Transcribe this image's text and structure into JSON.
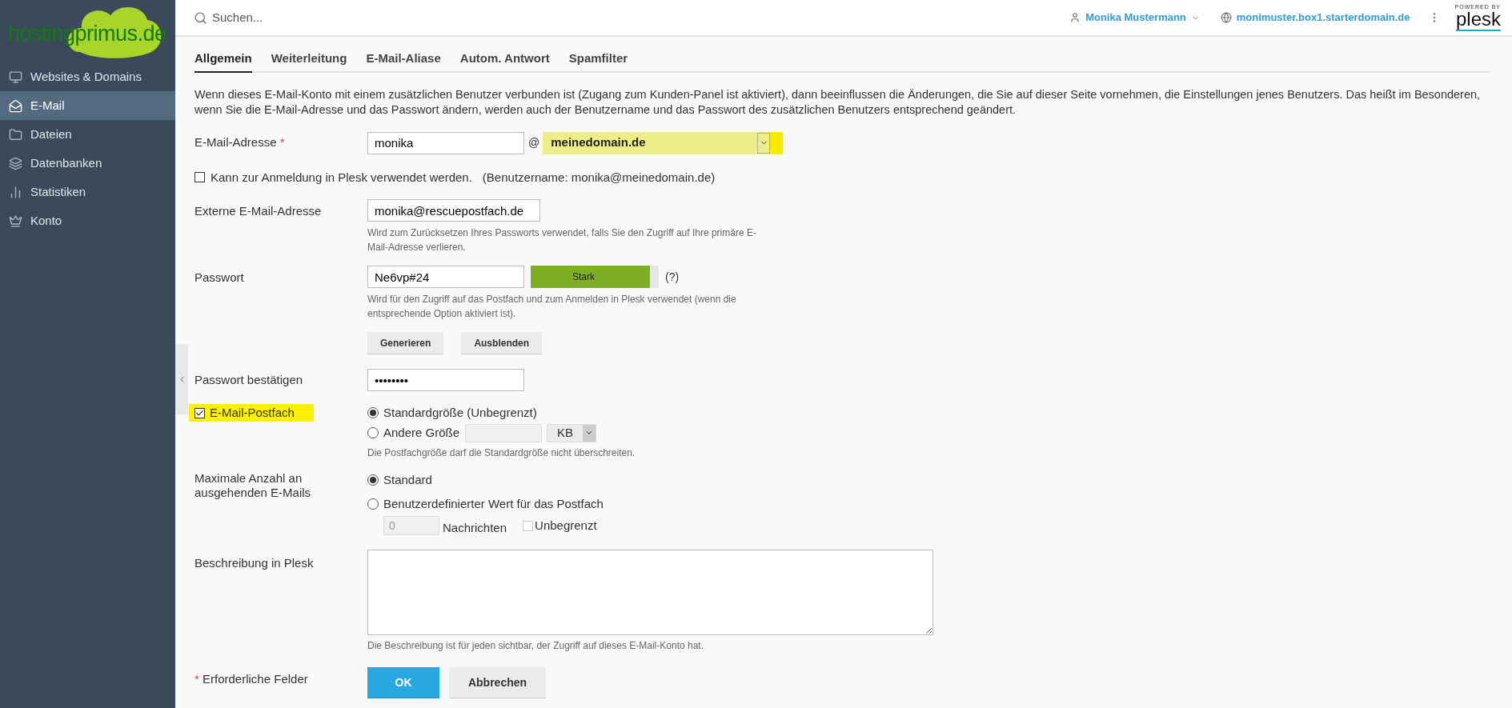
{
  "logo": {
    "text": "hostingprimus.de"
  },
  "sidebar": {
    "items": [
      {
        "label": "Websites & Domains",
        "selected": false
      },
      {
        "label": "E-Mail",
        "selected": true
      },
      {
        "label": "Dateien",
        "selected": false
      },
      {
        "label": "Datenbanken",
        "selected": false
      },
      {
        "label": "Statistiken",
        "selected": false
      },
      {
        "label": "Konto",
        "selected": false
      }
    ]
  },
  "topbar": {
    "search": {
      "placeholder": "Suchen..."
    },
    "user": "Monika Mustermann",
    "domain": "monimuster.box1.starterdomain.de",
    "brand": {
      "tagline": "POWERED BY",
      "name": "plesk"
    }
  },
  "tabs": [
    {
      "label": "Allgemein",
      "selected": true
    },
    {
      "label": "Weiterleitung",
      "selected": false
    },
    {
      "label": "E-Mail-Aliase",
      "selected": false
    },
    {
      "label": "Autom. Antwort",
      "selected": false
    },
    {
      "label": "Spamfilter",
      "selected": false
    }
  ],
  "intro": "Wenn dieses E-Mail-Konto mit einem zusätzlichen Benutzer verbunden ist (Zugang zum Kunden-Panel ist aktiviert), dann beeinflussen die Änderungen, die Sie auf dieser Seite vornehmen, die Einstellungen jenes Benutzers. Das heißt im Besonderen, wenn Sie die E-Mail-Adresse und das Passwort ändern, werden auch der Benutzername und das Passwort des zusätzlichen Benutzers entsprechend geändert.",
  "form": {
    "email": {
      "label": "E-Mail-Adresse",
      "required_mark": "*",
      "local": "monika",
      "at": "@",
      "domain": "meinedomain.de",
      "highlighted": true
    },
    "plesk_login": {
      "checked": false,
      "label": "Kann zur Anmeldung in Plesk verwendet werden.",
      "note": "(Benutzername: monika@meinedomain.de)"
    },
    "external": {
      "label": "Externe E-Mail-Adresse",
      "value": "monika@rescuepostfach.de",
      "hint": "Wird zum Zurücksetzen Ihres Passworts verwendet, falls Sie den Zugriff auf Ihre primäre E-Mail-Adresse verlieren."
    },
    "password": {
      "label": "Passwort",
      "value": "Ne6vp#24",
      "strength": {
        "label": "Stark",
        "level": 0.93
      },
      "help": "(?)",
      "hint": "Wird für den Zugriff auf das Postfach und zum Anmelden in Plesk verwendet (wenn die entsprechende Option aktiviert ist).",
      "buttons": [
        "Generieren",
        "Ausblenden"
      ]
    },
    "confirm": {
      "label": "Passwort bestätigen",
      "value": "••••••••"
    },
    "mailbox": {
      "label": "E-Mail-Postfach",
      "checked": true,
      "highlighted": true,
      "options": [
        {
          "label": "Standardgröße (Unbegrenzt)",
          "selected": true
        },
        {
          "label": "Andere Größe",
          "selected": false
        }
      ],
      "unit": "KB",
      "hint": "Die Postfachgröße darf die Standardgröße nicht überschreiten."
    },
    "outgoing": {
      "label": "Maximale Anzahl an ausgehenden E-Mails",
      "options": [
        {
          "label": "Standard",
          "selected": true
        },
        {
          "label": "Benutzerdefinierter Wert für das Postfach",
          "selected": false
        }
      ],
      "count": "0",
      "unit": "Nachrichten",
      "unlimited": {
        "label": "Unbegrenzt",
        "checked": false
      }
    },
    "description": {
      "label": "Beschreibung in Plesk",
      "hint": "Die Beschreibung ist für jeden sichtbar, der Zugriff auf dieses E-Mail-Konto hat."
    },
    "required": {
      "mark": "*",
      "label": "Erforderliche Felder"
    },
    "buttons": {
      "ok": "OK",
      "cancel": "Abbrechen"
    }
  }
}
